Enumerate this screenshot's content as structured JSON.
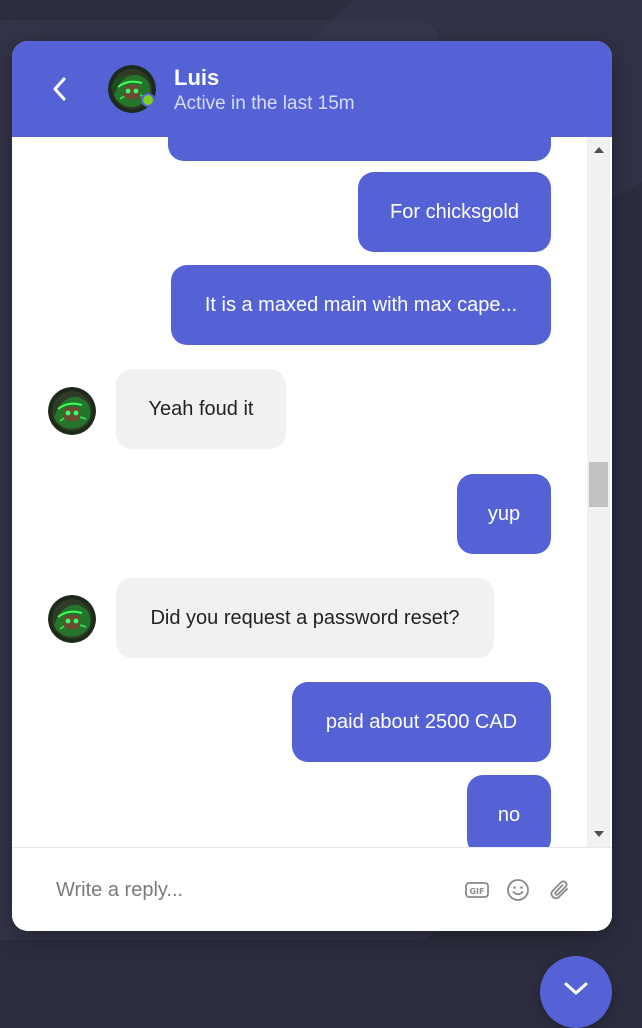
{
  "header": {
    "name": "Luis",
    "status": "Active in the last 15m"
  },
  "messages": [
    {
      "direction": "out",
      "text": ""
    },
    {
      "direction": "out",
      "text": "For chicksgold"
    },
    {
      "direction": "out",
      "text": "It is a maxed main with max cape..."
    },
    {
      "direction": "in",
      "text": "Yeah foud it"
    },
    {
      "direction": "out",
      "text": "yup"
    },
    {
      "direction": "in",
      "text": "Did you request a password reset?"
    },
    {
      "direction": "out",
      "text": "paid about 2500 CAD"
    },
    {
      "direction": "out",
      "text": "no"
    }
  ],
  "composer": {
    "placeholder": "Write a reply...",
    "gif_label": "GIF"
  },
  "colors": {
    "accent": "#5462d5",
    "incoming_bubble": "#f1f1f1",
    "online": "#7ed321"
  },
  "icons": {
    "back": "chevron-left-icon",
    "gif": "gif-icon",
    "emoji": "smiley-icon",
    "attach": "paperclip-icon",
    "scroll_down": "chevron-down-icon"
  }
}
